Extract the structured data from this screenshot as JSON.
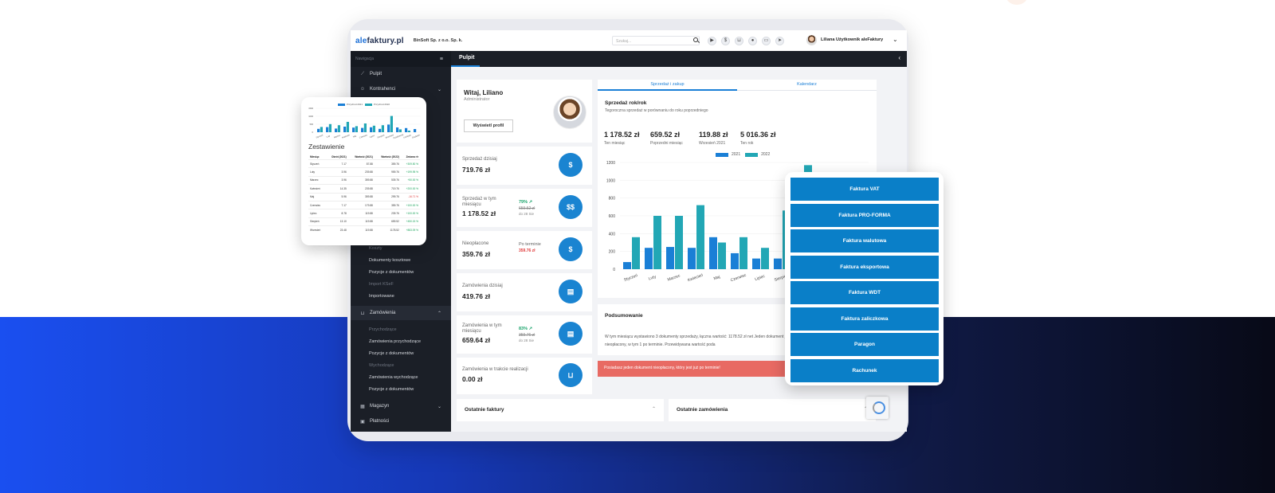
{
  "topbar": {
    "logo_prefix": "ale",
    "logo_suffix": "faktury.pl",
    "company": "BinSoft Sp. z o.o. Sp. k.",
    "search_placeholder": "Szukaj...",
    "user_name": "Liliana Użytkownik aleFaktury",
    "icons": [
      "youtube-icon",
      "coin-icon",
      "cart-icon",
      "chat-icon",
      "print-icon",
      "send-icon"
    ]
  },
  "sidebar": {
    "header": "Nawigacja",
    "items": {
      "pulpit": "Pulpit",
      "kontrahenci": "Kontrahenci",
      "zamowienia": "Zamówienia",
      "magazyn": "Magazyn",
      "platnosci": "Płatności"
    },
    "subitems": {
      "koszty": "Koszty",
      "dokumenty_kosztowe": "Dokumenty kosztowe",
      "pozycje_dok_1": "Pozycje z dokumentów",
      "import_ksef": "Import KSeF",
      "importowane": "Importowane",
      "przychodzace": "Przychodzące",
      "zam_przychodzace": "Zamówienia przychodzące",
      "pozycje_dok_2": "Pozycje z dokumentów",
      "wychodzace": "Wychodzące",
      "zam_wychodzace": "Zamówienia wychodzące",
      "pozycje_dok_3": "Pozycje z dokumentów"
    }
  },
  "main": {
    "title": "Pulpit",
    "welcome": {
      "name": "Witaj, Liliano",
      "role": "Administrator",
      "profile_button": "Wyświetl profil"
    },
    "stats": [
      {
        "label": "Sprzedaż dzisiaj",
        "value": "719.76 zł",
        "icon": "$"
      },
      {
        "label": "Sprzedaż w tym miesiącu",
        "value": "1 178.52 zł",
        "pct": "79% ↗",
        "old": "659.52 zł",
        "sub": "do 28 Sie",
        "icon": "$$"
      },
      {
        "label": "Nieopłacone",
        "value": "359.76 zł",
        "term_label": "Po terminie",
        "term_value": "359.76 zł",
        "icon": "$"
      },
      {
        "label": "Zamówienia dzisiaj",
        "value": "419.76 zł",
        "icon": "▤"
      },
      {
        "label": "Zamówienia w tym miesiącu",
        "value": "659.64 zł",
        "pct": "83% ↗",
        "old": "359.76 zł",
        "sub": "do 28 Sie",
        "icon": "▤"
      },
      {
        "label": "Zamówienia w trakcie realizacji",
        "value": "0.00 zł",
        "icon": "🛒"
      }
    ],
    "tabs": [
      "Sprzedaż i zakup",
      "Kalendarz"
    ],
    "chart_card": {
      "title": "Sprzedaż rok/rok",
      "subtitle": "Tegoroczna sprzedaż w porównaniu do roku poprzedniego",
      "kpis": [
        {
          "value": "1 178.52 zł",
          "label": "Ten miesiąc"
        },
        {
          "value": "659.52 zł",
          "label": "Poprzedni miesiąc"
        },
        {
          "value": "119.88 zł",
          "label": "Wrzesień 2021"
        },
        {
          "value": "5 016.36 zł",
          "label": "Ten rok"
        }
      ]
    },
    "summary": {
      "title": "Podsumowanie",
      "text": "W tym miesiącu wystawiono 3 dokumenty sprzedaży, łączna wartość: 1178.52 zł net Jeden dokument jest nieopłacony, w tym 1 po terminie. Przewidywana wartość poda"
    },
    "alert": "Posiadasz jeden dokument nieopłacony, który jest już po terminie!",
    "bottom_cards": [
      "Ostatnie faktury",
      "Ostatnie zamówienia"
    ]
  },
  "chart_data": [
    {
      "type": "bar",
      "title": "",
      "categories": [
        "Styczeń",
        "Luty",
        "Marzec",
        "Kwiecień",
        "Maj",
        "Czerwiec",
        "Lipiec",
        "Sierpień",
        "Wrzesień"
      ],
      "series": [
        {
          "name": "2021",
          "values": [
            80,
            240,
            250,
            240,
            360,
            180,
            120,
            120,
            300
          ]
        },
        {
          "name": "2022",
          "values": [
            360,
            600,
            600,
            720,
            300,
            360,
            240,
            660,
            1170
          ]
        }
      ],
      "ylim": [
        0,
        1200
      ],
      "yticks": [
        0,
        200,
        400,
        600,
        800,
        1000,
        1200
      ],
      "legend": "top-center",
      "colors": {
        "2021": "#1a7fd6",
        "2022": "#22a7b5"
      }
    },
    {
      "type": "bar",
      "title": "",
      "categories": [
        "Styczeń",
        "Luty",
        "Marzec",
        "Kwiecień",
        "Maj",
        "Czerwiec",
        "Lipiec",
        "Sierpień",
        "Wrzesień",
        "Październik",
        "Listopad",
        "Grudzień"
      ],
      "series": [
        {
          "name": "Przychód 2021",
          "values": [
            210,
            320,
            230,
            350,
            290,
            270,
            310,
            210,
            480,
            300,
            260,
            200
          ]
        },
        {
          "name": "Przychód 2022",
          "values": [
            330,
            510,
            440,
            650,
            380,
            550,
            410,
            440,
            1020,
            180,
            100,
            0
          ]
        }
      ],
      "ylim": [
        0,
        1500
      ],
      "yticks": [
        0,
        500,
        1000,
        1500
      ],
      "legend": "top-center",
      "colors": {
        "Przychód 2021": "#1a7fd6",
        "Przychód 2022": "#22a7b5"
      }
    }
  ],
  "zestawienie": {
    "title": "Zestawienie",
    "headers": [
      "Miesiąc",
      "Obrót (2021)",
      "Wartość (2021)",
      "Wartość (2022)",
      "Zmiana r/r"
    ],
    "rows": [
      [
        "Styczeń",
        "7.17",
        "87.88",
        "359.76",
        "+309.50 %"
      ],
      [
        "Luty",
        "3.96",
        "239.88",
        "959.76",
        "+199.95 %"
      ],
      [
        "Marzec",
        "3.96",
        "359.88",
        "539.76",
        "+50.00 %"
      ],
      [
        "Kwiecień",
        "14.35",
        "239.88",
        "719.76",
        "+200.00 %"
      ],
      [
        "Maj",
        "5.96",
        "359.88",
        "299.76",
        "-16.71 %"
      ],
      [
        "Czerwiec",
        "7.17",
        "179.88",
        "359.76",
        "+100.00 %"
      ],
      [
        "Lipiec",
        "8.78",
        "119.88",
        "239.76",
        "+100.00 %"
      ],
      [
        "Sierpień",
        "13.10",
        "119.88",
        "659.52",
        "+450.15 %"
      ],
      [
        "Wrzesień",
        "23.48",
        "119.88",
        "1178.52",
        "+883.09 %"
      ]
    ]
  },
  "invoice_buttons": [
    "Faktura VAT",
    "Faktura PRO-FORMA",
    "Faktura walutowa",
    "Faktura eksportowa",
    "Faktura WDT",
    "Faktura zaliczkowa",
    "Paragon",
    "Rachunek"
  ]
}
